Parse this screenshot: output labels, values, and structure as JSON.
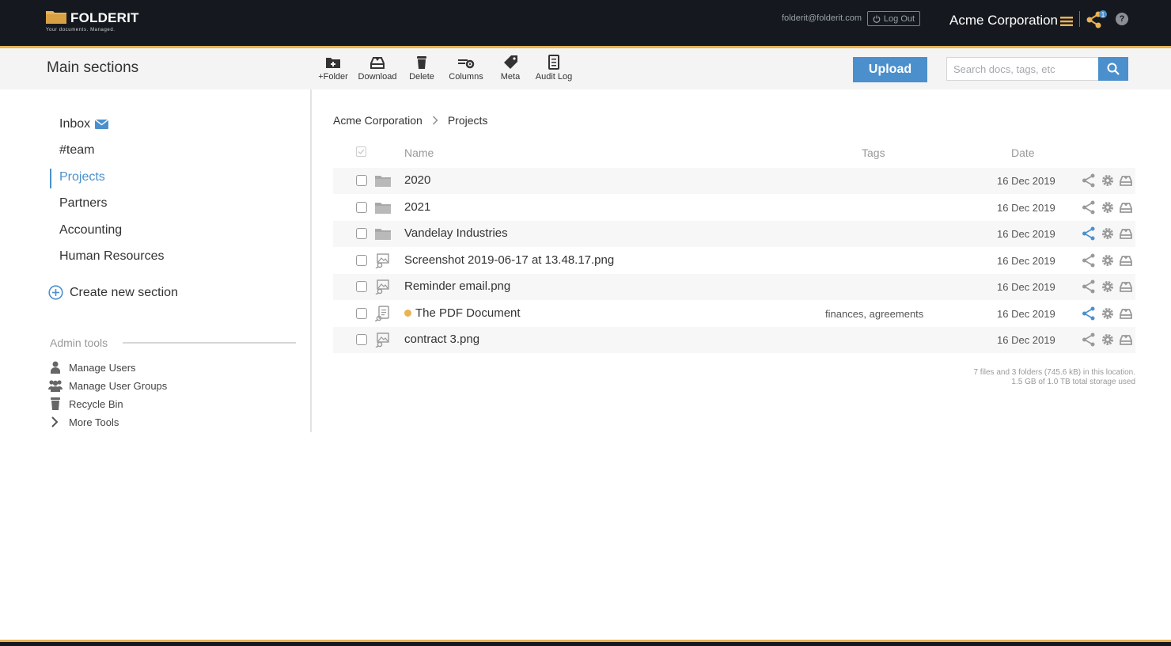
{
  "brand": {
    "name": "FOLDERIT",
    "tagline": "Your documents. Managed."
  },
  "header": {
    "user_email": "folderit@folderit.com",
    "logout_label": "Log Out",
    "org_name": "Acme Corporation",
    "notification_count": "1",
    "help_label": "?"
  },
  "toolbar": {
    "title": "Main sections",
    "tools": [
      {
        "label": "+Folder",
        "icon": "folder-plus-icon"
      },
      {
        "label": "Download",
        "icon": "download-icon"
      },
      {
        "label": "Delete",
        "icon": "trash-icon"
      },
      {
        "label": "Columns",
        "icon": "columns-gear-icon"
      },
      {
        "label": "Meta",
        "icon": "tag-icon"
      },
      {
        "label": "Audit Log",
        "icon": "document-icon"
      }
    ],
    "upload_label": "Upload",
    "search_placeholder": "Search docs, tags, etc"
  },
  "sidebar": {
    "sections": [
      {
        "label": "Inbox"
      },
      {
        "label": "#team"
      },
      {
        "label": "Projects"
      },
      {
        "label": "Partners"
      },
      {
        "label": "Accounting"
      },
      {
        "label": "Human Resources"
      }
    ],
    "active_section": "Projects",
    "create_label": "Create new section",
    "admin_title": "Admin tools",
    "admin_items": [
      {
        "label": "Manage Users",
        "icon": "user-icon"
      },
      {
        "label": "Manage User Groups",
        "icon": "users-icon"
      },
      {
        "label": "Recycle Bin",
        "icon": "trash-icon"
      },
      {
        "label": "More Tools",
        "icon": "chevron-right-icon"
      }
    ]
  },
  "breadcrumb": {
    "root": "Acme Corporation",
    "current": "Projects"
  },
  "table": {
    "columns": {
      "name": "Name",
      "tags": "Tags",
      "date": "Date"
    },
    "rows": [
      {
        "type": "folder",
        "name": "2020",
        "tags": "",
        "date": "16 Dec 2019",
        "shared": false,
        "status": false
      },
      {
        "type": "folder",
        "name": "2021",
        "tags": "",
        "date": "16 Dec 2019",
        "shared": false,
        "status": false
      },
      {
        "type": "folder",
        "name": "Vandelay Industries",
        "tags": "",
        "date": "16 Dec 2019",
        "shared": true,
        "status": false
      },
      {
        "type": "image",
        "name": "Screenshot 2019-06-17 at 13.48.17.png",
        "tags": "",
        "date": "16 Dec 2019",
        "shared": false,
        "status": false
      },
      {
        "type": "image",
        "name": "Reminder email.png",
        "tags": "",
        "date": "16 Dec 2019",
        "shared": false,
        "status": false
      },
      {
        "type": "document",
        "name": "The PDF Document",
        "tags": "finances, agreements",
        "date": "16 Dec 2019",
        "shared": true,
        "status": true
      },
      {
        "type": "image",
        "name": "contract 3.png",
        "tags": "",
        "date": "16 Dec 2019",
        "shared": false,
        "status": false
      }
    ]
  },
  "storage": {
    "line1": "7 files and 3 folders (745.6 kB) in this location.",
    "line2": "1.5 GB of 1.0 TB total storage used"
  },
  "colors": {
    "accent": "#4b90cc",
    "brand": "#e9b254",
    "topbar": "#15191f",
    "shared": "#4b90cc",
    "icon_gray": "#9a9a9a"
  }
}
